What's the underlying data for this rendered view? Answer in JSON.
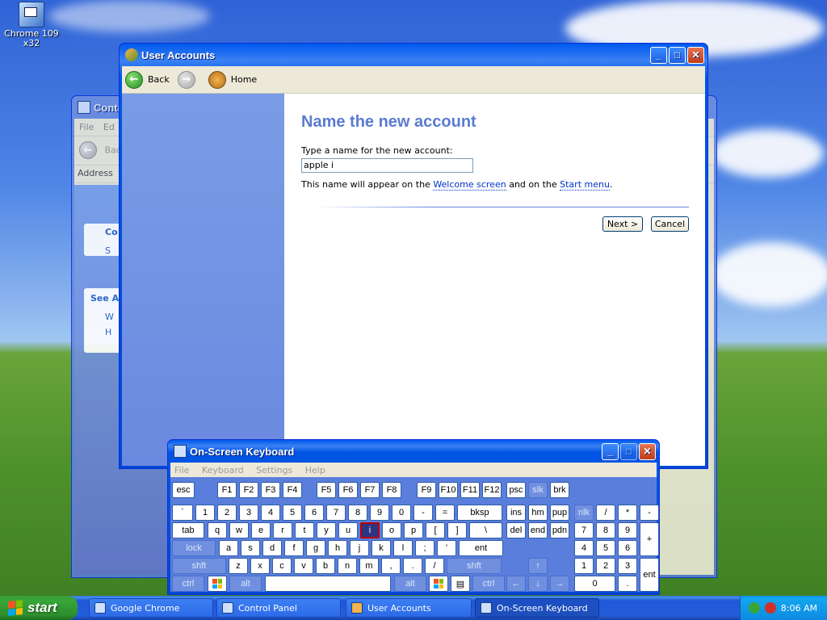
{
  "desktop": {
    "icon_label": "Chrome 109\nx32"
  },
  "control_panel": {
    "title": "Contr",
    "menu": [
      "File",
      "Ed"
    ],
    "back": "Bac",
    "address": "Address",
    "see_also": "See A",
    "task_letters": [
      "Co",
      "S",
      "W",
      "H"
    ]
  },
  "user_accounts": {
    "title": "User Accounts",
    "back": "Back",
    "home": "Home",
    "heading": "Name the new account",
    "prompt": "Type a name for the new account:",
    "name_value": "apple i",
    "note_prefix": "This name will appear on the ",
    "note_link1": "Welcome screen",
    "note_mid": " and on the ",
    "note_link2": "Start menu",
    "note_suffix": ".",
    "next": "Next >",
    "cancel": "Cancel"
  },
  "osk": {
    "title": "On-Screen Keyboard",
    "menu": [
      "File",
      "Keyboard",
      "Settings",
      "Help"
    ],
    "rows": [
      [
        [
          "esc",
          ""
        ],
        [
          "F1",
          ""
        ],
        [
          "F2",
          ""
        ],
        [
          "F3",
          ""
        ],
        [
          "F4",
          ""
        ],
        [
          "F5",
          ""
        ],
        [
          "F6",
          ""
        ],
        [
          "F7",
          ""
        ],
        [
          "F8",
          ""
        ],
        [
          "F9",
          ""
        ],
        [
          "F10",
          ""
        ],
        [
          "F11",
          ""
        ],
        [
          "F12",
          ""
        ],
        [
          "psc",
          ""
        ],
        [
          "slk",
          "dim"
        ],
        [
          "brk",
          ""
        ]
      ],
      [
        [
          "`",
          ""
        ],
        [
          "1",
          ""
        ],
        [
          "2",
          ""
        ],
        [
          "3",
          ""
        ],
        [
          "4",
          ""
        ],
        [
          "5",
          ""
        ],
        [
          "6",
          ""
        ],
        [
          "7",
          ""
        ],
        [
          "8",
          ""
        ],
        [
          "9",
          ""
        ],
        [
          "0",
          ""
        ],
        [
          "-",
          ""
        ],
        [
          "=",
          ""
        ],
        [
          "bksp",
          ""
        ],
        [
          "ins",
          ""
        ],
        [
          "hm",
          ""
        ],
        [
          "pup",
          ""
        ],
        [
          "nlk",
          "dim"
        ],
        [
          "/",
          ""
        ],
        [
          "*",
          ""
        ],
        [
          "-",
          ""
        ]
      ],
      [
        [
          "tab",
          ""
        ],
        [
          "q",
          ""
        ],
        [
          "w",
          ""
        ],
        [
          "e",
          ""
        ],
        [
          "r",
          ""
        ],
        [
          "t",
          ""
        ],
        [
          "y",
          ""
        ],
        [
          "u",
          ""
        ],
        [
          "i",
          "hot"
        ],
        [
          "o",
          ""
        ],
        [
          "p",
          ""
        ],
        [
          "[",
          ""
        ],
        [
          "]",
          ""
        ],
        [
          "\\",
          ""
        ],
        [
          "del",
          ""
        ],
        [
          "end",
          ""
        ],
        [
          "pdn",
          ""
        ],
        [
          "7",
          ""
        ],
        [
          "8",
          ""
        ],
        [
          "9",
          ""
        ],
        [
          "+",
          ""
        ]
      ],
      [
        [
          "lock",
          "dim"
        ],
        [
          "a",
          ""
        ],
        [
          "s",
          ""
        ],
        [
          "d",
          ""
        ],
        [
          "f",
          ""
        ],
        [
          "g",
          ""
        ],
        [
          "h",
          ""
        ],
        [
          "j",
          ""
        ],
        [
          "k",
          ""
        ],
        [
          "l",
          ""
        ],
        [
          ";",
          ""
        ],
        [
          "'",
          ""
        ],
        [
          "ent",
          ""
        ],
        [
          "4",
          ""
        ],
        [
          "5",
          ""
        ],
        [
          "6",
          ""
        ]
      ],
      [
        [
          "shft",
          "dim"
        ],
        [
          "z",
          ""
        ],
        [
          "x",
          ""
        ],
        [
          "c",
          ""
        ],
        [
          "v",
          ""
        ],
        [
          "b",
          ""
        ],
        [
          "n",
          ""
        ],
        [
          "m",
          ""
        ],
        [
          ",",
          ""
        ],
        [
          ".",
          ""
        ],
        [
          "/",
          ""
        ],
        [
          "shft",
          "dim"
        ],
        [
          "↑",
          "dim"
        ],
        [
          "1",
          ""
        ],
        [
          "2",
          ""
        ],
        [
          "3",
          ""
        ],
        [
          "ent",
          ""
        ]
      ],
      [
        [
          "ctrl",
          "dim"
        ],
        [
          "win",
          ""
        ],
        [
          "alt",
          "dim"
        ],
        [
          "",
          ""
        ],
        [
          "alt",
          "dim"
        ],
        [
          "win",
          ""
        ],
        [
          "menu",
          ""
        ],
        [
          "ctrl",
          "dim"
        ],
        [
          "←",
          "dim"
        ],
        [
          "↓",
          "dim"
        ],
        [
          "→",
          "dim"
        ],
        [
          "0",
          ""
        ],
        [
          ".",
          ""
        ]
      ]
    ]
  },
  "taskbar": {
    "start": "start",
    "items": [
      "Google Chrome",
      "Control Panel",
      "User Accounts",
      "On-Screen Keyboard"
    ],
    "clock": "8:06 AM"
  },
  "colors": {
    "heading": "#5a7bd1",
    "link": "#0033cc",
    "taskbar": "#245edb",
    "osk_panel": "#5a7edc"
  }
}
